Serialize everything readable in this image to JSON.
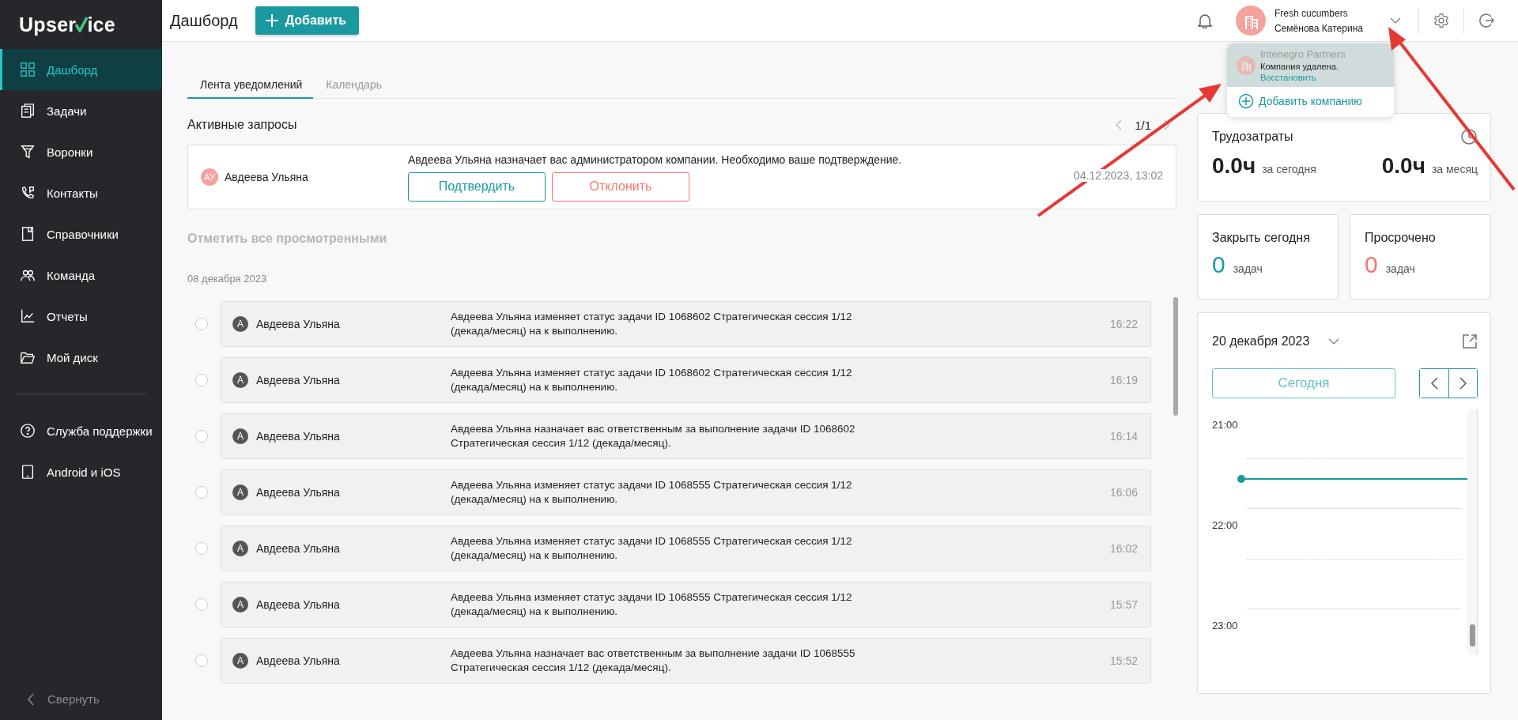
{
  "sidebar": {
    "logo_start": "Upser",
    "logo_end": "ice",
    "items": [
      {
        "label": "Дашборд",
        "selected": true
      },
      {
        "label": "Задачи",
        "selected": false
      },
      {
        "label": "Воронки",
        "selected": false
      },
      {
        "label": "Контакты",
        "selected": false
      },
      {
        "label": "Справочники",
        "selected": false
      },
      {
        "label": "Команда",
        "selected": false
      },
      {
        "label": "Отчеты",
        "selected": false
      },
      {
        "label": "Мой диск",
        "selected": false
      }
    ],
    "extra_items": [
      {
        "label": "Служба поддержки"
      },
      {
        "label": "Android и iOS"
      }
    ],
    "collapse": "Свернуть"
  },
  "header": {
    "title": "Дашборд",
    "add_button": "Добавить",
    "company": "Fresh cucumbers",
    "user": "Семёнова Катерина"
  },
  "company_menu": {
    "companies": [
      {
        "name": "Intenegro Partners",
        "status": "Компания удалена.",
        "action": "Восстановить",
        "deleted": true
      }
    ],
    "add": "Добавить компанию"
  },
  "tabs": [
    {
      "label": "Лента уведомлений",
      "selected": true
    },
    {
      "label": "Календарь",
      "selected": false
    }
  ],
  "requests": {
    "title": "Активные запросы",
    "pager": "1/1",
    "items": [
      {
        "initials": "АУ",
        "name": "Авдеева Ульяна",
        "message": "Авдеева Ульяна назначает вас администратором компании. Необходимо ваше подтверждение.",
        "confirm": "Подтвердить",
        "reject": "Отклонить",
        "time": "04.12.2023, 13:02"
      }
    ]
  },
  "mark_all": {
    "label": "Отметить все просмотренными",
    "disabled": true
  },
  "feed": {
    "date": "08 декабря 2023",
    "items": [
      {
        "initial": "А",
        "name": "Авдеева Ульяна",
        "text": "Авдеева Ульяна изменяет статус задачи ID 1068602 Стратегическая сессия 1/12 (декада/месяц) на к выполнению.",
        "time": "16:22",
        "checked": false
      },
      {
        "initial": "А",
        "name": "Авдеева Ульяна",
        "text": "Авдеева Ульяна изменяет статус задачи ID 1068602 Стратегическая сессия 1/12 (декада/месяц) на к выполнению.",
        "time": "16:19",
        "checked": false
      },
      {
        "initial": "А",
        "name": "Авдеева Ульяна",
        "text": "Авдеева Ульяна назначает вас ответственным за выполнение задачи ID 1068602 Стратегическая сессия 1/12 (декада/месяц).",
        "time": "16:14",
        "checked": false
      },
      {
        "initial": "А",
        "name": "Авдеева Ульяна",
        "text": "Авдеева Ульяна изменяет статус задачи ID 1068555 Стратегическая сессия 1/12 (декада/месяц) на к выполнению.",
        "time": "16:06",
        "checked": false
      },
      {
        "initial": "А",
        "name": "Авдеева Ульяна",
        "text": "Авдеева Ульяна изменяет статус задачи ID 1068555 Стратегическая сессия 1/12 (декада/месяц) на к выполнению.",
        "time": "16:02",
        "checked": false
      },
      {
        "initial": "А",
        "name": "Авдеева Ульяна",
        "text": "Авдеева Ульяна изменяет статус задачи ID 1068555 Стратегическая сессия 1/12 (декада/месяц) на к выполнению.",
        "time": "15:57",
        "checked": false
      },
      {
        "initial": "А",
        "name": "Авдеева Ульяна",
        "text": "Авдеева Ульяна назначает вас ответственным за выполнение задачи ID 1068555 Стратегическая сессия 1/12 (декада/месяц).",
        "time": "15:52",
        "checked": false
      }
    ]
  },
  "labor": {
    "title": "Трудозатраты",
    "today_value": "0.0ч",
    "today_label": "за сегодня",
    "month_value": "0.0ч",
    "month_label": "за месяц"
  },
  "stats": [
    {
      "title": "Закрыть сегодня",
      "value": "0",
      "unit": "задач",
      "color": "#1a9a9e"
    },
    {
      "title": "Просрочено",
      "value": "0",
      "unit": "задач",
      "color": "#f7736d"
    }
  ],
  "calendar": {
    "date": "20 декабря 2023",
    "today_button": "Сегодня",
    "hours": [
      "21:00",
      "22:00",
      "23:00"
    ]
  }
}
